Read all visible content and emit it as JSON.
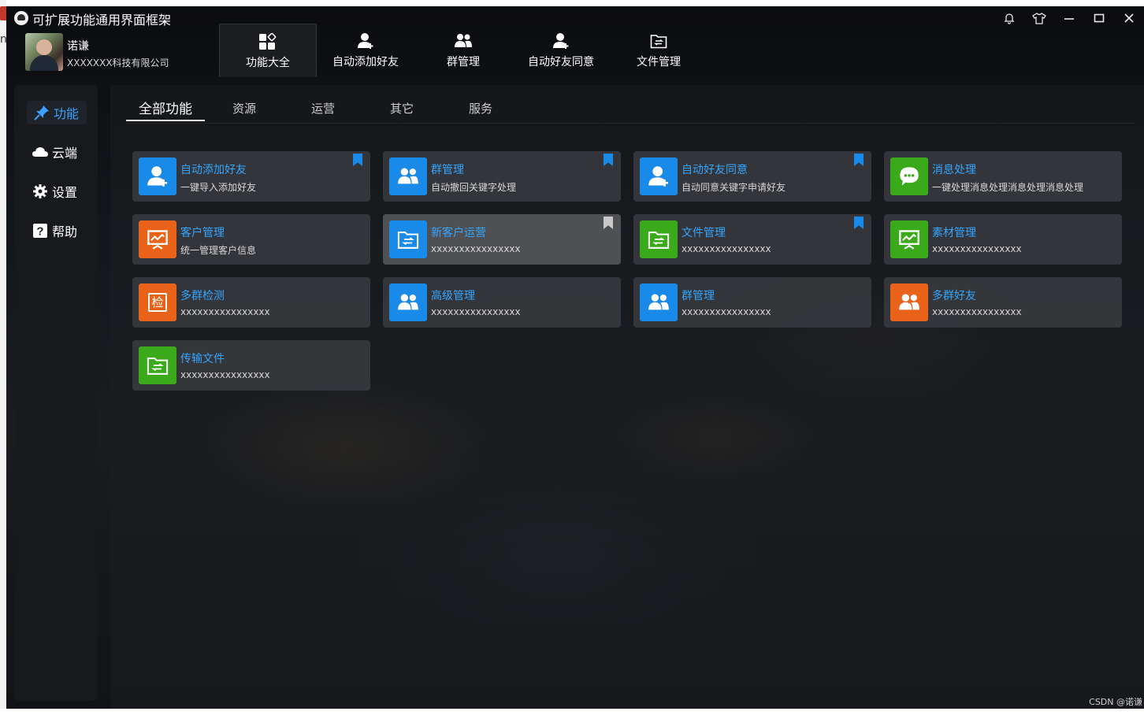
{
  "app": {
    "title": "可扩展功能通用界面框架"
  },
  "user": {
    "name": "诺谦",
    "company": "XXXXXXX科技有限公司"
  },
  "window_controls": [
    "bell-icon",
    "shirt-icon",
    "minimize-icon",
    "maximize-icon",
    "close-icon"
  ],
  "topnav": [
    {
      "label": "功能大全",
      "icon": "grid-apps-icon",
      "active": true
    },
    {
      "label": "自动添加好友",
      "icon": "user-add-icon"
    },
    {
      "label": "群管理",
      "icon": "group-icon"
    },
    {
      "label": "自动好友同意",
      "icon": "user-add-icon"
    },
    {
      "label": "文件管理",
      "icon": "folder-transfer-icon"
    }
  ],
  "sidebar": [
    {
      "label": "功能",
      "icon": "pin-icon",
      "active": true
    },
    {
      "label": "云端",
      "icon": "cloud-icon"
    },
    {
      "label": "设置",
      "icon": "gear-icon"
    },
    {
      "label": "帮助",
      "icon": "help-icon"
    }
  ],
  "tabs": [
    {
      "label": "全部功能",
      "active": true
    },
    {
      "label": "资源"
    },
    {
      "label": "运营"
    },
    {
      "label": "其它"
    },
    {
      "label": "服务"
    }
  ],
  "colors": {
    "accent": "#35a5ff",
    "blue": "#1a8ae8",
    "orange": "#e8621a",
    "green": "#3aaa1a"
  },
  "cards": [
    {
      "title": "自动添加好友",
      "desc": "一键导入添加好友",
      "icon": "user-add-icon",
      "color": "#1a8ae8",
      "bookmark": "blue"
    },
    {
      "title": "群管理",
      "desc": "自动撤回关键字处理",
      "icon": "group-icon",
      "color": "#1a8ae8",
      "bookmark": "blue"
    },
    {
      "title": "自动好友同意",
      "desc": "自动同意关键字申请好友",
      "icon": "user-add-icon",
      "color": "#1a8ae8",
      "bookmark": "blue"
    },
    {
      "title": "消息处理",
      "desc": "一键处理消息处理消息处理消息处理",
      "icon": "chat-icon",
      "color": "#3aaa1a",
      "bookmark": ""
    },
    {
      "title": "客户管理",
      "desc": "统一管理客户信息",
      "icon": "presentation-icon",
      "color": "#e8621a",
      "bookmark": ""
    },
    {
      "title": "新客户运营",
      "desc": "xxxxxxxxxxxxxxxx",
      "icon": "folder-transfer-icon",
      "color": "#1a8ae8",
      "bookmark": "gray",
      "hover": true
    },
    {
      "title": "文件管理",
      "desc": "xxxxxxxxxxxxxxxx",
      "icon": "folder-transfer-icon",
      "color": "#3aaa1a",
      "bookmark": "blue"
    },
    {
      "title": "素材管理",
      "desc": "xxxxxxxxxxxxxxxx",
      "icon": "presentation-icon",
      "color": "#3aaa1a",
      "bookmark": ""
    },
    {
      "title": "多群检测",
      "desc": "xxxxxxxxxxxxxxxx",
      "icon": "check-seal-icon",
      "color": "#e8621a",
      "bookmark": "",
      "glyph": "检"
    },
    {
      "title": "高级管理",
      "desc": "xxxxxxxxxxxxxxxx",
      "icon": "group-icon",
      "color": "#1a8ae8",
      "bookmark": ""
    },
    {
      "title": "群管理",
      "desc": "xxxxxxxxxxxxxxxx",
      "icon": "group-icon",
      "color": "#1a8ae8",
      "bookmark": ""
    },
    {
      "title": "多群好友",
      "desc": "xxxxxxxxxxxxxxxx",
      "icon": "group-icon",
      "color": "#e8621a",
      "bookmark": ""
    },
    {
      "title": "传输文件",
      "desc": "xxxxxxxxxxxxxxxx",
      "icon": "folder-transfer-icon",
      "color": "#3aaa1a",
      "bookmark": ""
    }
  ],
  "watermark": "CSDN @诺谦",
  "desktop_fragment": "n"
}
